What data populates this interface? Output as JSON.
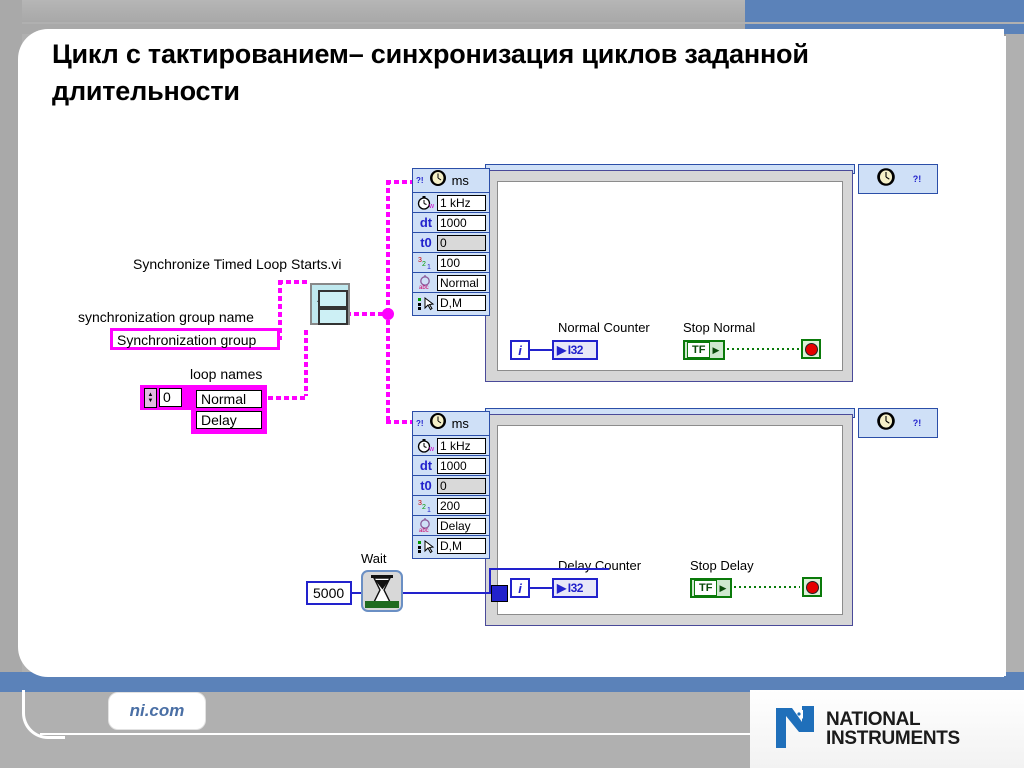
{
  "slide": {
    "title": "Цикл с тактированием– синхронизация циклов заданной длительности",
    "footer_link": "ni.com",
    "logo_line1": "NATIONAL",
    "logo_line2": "INSTRUMENTS",
    "accent_blue": "#5b82b9",
    "frame_gray": "#b0b0b0"
  },
  "diagram": {
    "subvi_label": "Synchronize Timed Loop Starts.vi",
    "sync_group_label": "synchronization group name",
    "sync_group_value": "Synchronization group",
    "loop_names_label": "loop names",
    "loop_names_index": "0",
    "loop_names_items": [
      "Normal",
      "Delay"
    ],
    "wait_label": "Wait",
    "wait_value": "5000",
    "wire_color_string": "#ff00ff",
    "wire_color_numeric": "#2222cc",
    "timed_loops": [
      {
        "id": "normal-loop",
        "unit_label": "ms",
        "source_value": "1 kHz",
        "dt_label": "dt",
        "dt_value": "1000",
        "t0_label": "t0",
        "t0_value": "0",
        "priority_value": "100",
        "name_value": "Normal",
        "mode_value": "D,M",
        "counter_label": "Normal Counter",
        "counter_type": "I32",
        "iteration_terminal": "i",
        "stop_label": "Stop Normal",
        "stop_value": "TF"
      },
      {
        "id": "delay-loop",
        "unit_label": "ms",
        "source_value": "1 kHz",
        "dt_label": "dt",
        "dt_value": "1000",
        "t0_label": "t0",
        "t0_value": "0",
        "priority_value": "200",
        "name_value": "Delay",
        "mode_value": "D,M",
        "counter_label": "Delay Counter",
        "counter_type": "I32",
        "iteration_terminal": "i",
        "stop_label": "Stop Delay",
        "stop_value": "TF"
      }
    ],
    "node_icons": {
      "clock": "clock-icon",
      "question": "?!",
      "source_icon": "stopwatch-icon",
      "priority_icon": "priority-icon",
      "name_icon": "name-abc-icon",
      "mode_icon": "mode-pointer-icon"
    }
  }
}
